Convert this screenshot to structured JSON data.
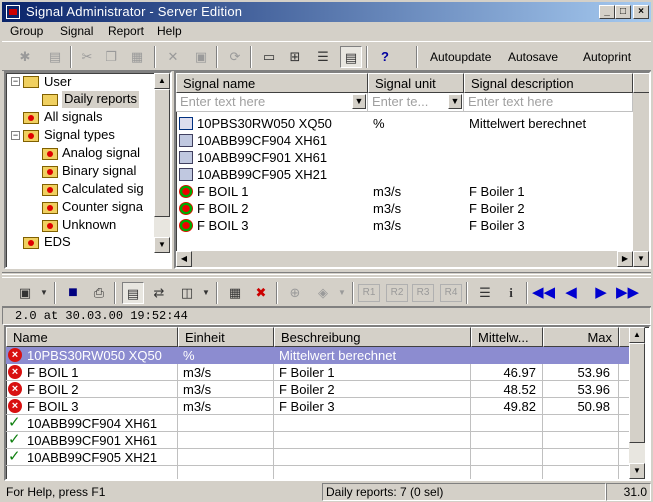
{
  "window": {
    "title": "Signal Administrator - Server Edition",
    "min": "_",
    "max": "□",
    "close": "×"
  },
  "menu": [
    "Group",
    "Signal",
    "Report",
    "Help"
  ],
  "toolbar": {
    "autoupdate": "Autoupdate",
    "autosave": "Autosave",
    "autoprint": "Autoprint"
  },
  "tree": {
    "items": [
      {
        "label": "User"
      },
      {
        "label": "Daily reports"
      },
      {
        "label": "All signals"
      },
      {
        "label": "Signal types"
      },
      {
        "label": "Analog signal"
      },
      {
        "label": "Binary signal"
      },
      {
        "label": "Calculated sig"
      },
      {
        "label": "Counter signa"
      },
      {
        "label": "Unknown"
      },
      {
        "label": "EDS"
      }
    ]
  },
  "signals": {
    "headers": [
      "Signal name",
      "Signal unit",
      "Signal description"
    ],
    "filters": [
      "Enter text here",
      "Enter te...",
      "Enter text here"
    ],
    "rows": [
      {
        "name": "10PBS30RW050 XQ50",
        "unit": "%",
        "desc": "Mittelwert berechnet",
        "icon": "analog-signal-icon"
      },
      {
        "name": "10ABB99CF904 XH61",
        "unit": "",
        "desc": "",
        "icon": "binary-signal-icon"
      },
      {
        "name": "10ABB99CF901 XH61",
        "unit": "",
        "desc": "",
        "icon": "binary-signal-icon"
      },
      {
        "name": "10ABB99CF905 XH21",
        "unit": "",
        "desc": "",
        "icon": "binary-signal-icon"
      },
      {
        "name": "F BOIL 1",
        "unit": "m3/s",
        "desc": "F Boiler 1",
        "icon": "calculated-signal-icon"
      },
      {
        "name": "F BOIL 2",
        "unit": "m3/s",
        "desc": "F Boiler 2",
        "icon": "calculated-signal-icon"
      },
      {
        "name": "F BOIL 3",
        "unit": "m3/s",
        "desc": "F Boiler 3",
        "icon": "calculated-signal-icon"
      }
    ]
  },
  "report_toolbar": {
    "buttons": [
      "R1",
      "R2",
      "R3",
      "R4"
    ]
  },
  "report_info": "2.0 at 30.03.00 19:52:44",
  "report": {
    "headers": [
      "Name",
      "Einheit",
      "Beschreibung",
      "Mittelw...",
      "Max"
    ],
    "rows": [
      {
        "name": "10PBS30RW050 XQ50",
        "unit": "%",
        "desc": "Mittelwert berechnet",
        "avg": "",
        "max": "",
        "status": "error",
        "selected": true
      },
      {
        "name": "F BOIL 1",
        "unit": "m3/s",
        "desc": "F Boiler 1",
        "avg": "46.97",
        "max": "53.96",
        "status": "error",
        "selected": false
      },
      {
        "name": "F BOIL 2",
        "unit": "m3/s",
        "desc": "F Boiler 2",
        "avg": "48.52",
        "max": "53.96",
        "status": "error",
        "selected": false
      },
      {
        "name": "F BOIL 3",
        "unit": "m3/s",
        "desc": "F Boiler 3",
        "avg": "49.82",
        "max": "50.98",
        "status": "error",
        "selected": false
      },
      {
        "name": "10ABB99CF904 XH61",
        "unit": "",
        "desc": "",
        "avg": "",
        "max": "",
        "status": "ok",
        "selected": false
      },
      {
        "name": "10ABB99CF901 XH61",
        "unit": "",
        "desc": "",
        "avg": "",
        "max": "",
        "status": "ok",
        "selected": false
      },
      {
        "name": "10ABB99CF905 XH21",
        "unit": "",
        "desc": "",
        "avg": "",
        "max": "",
        "status": "ok",
        "selected": false
      }
    ]
  },
  "status": {
    "help": "For Help, press F1",
    "reports": "Daily reports: 7 (0 sel)",
    "right": "31.0"
  },
  "colors": {
    "title_start": "#0a246a",
    "title_end": "#a6caf0",
    "selection": "#8c8cd0",
    "error": "#d81010",
    "ok": "#108010",
    "nav_blue": "#0000d0"
  }
}
